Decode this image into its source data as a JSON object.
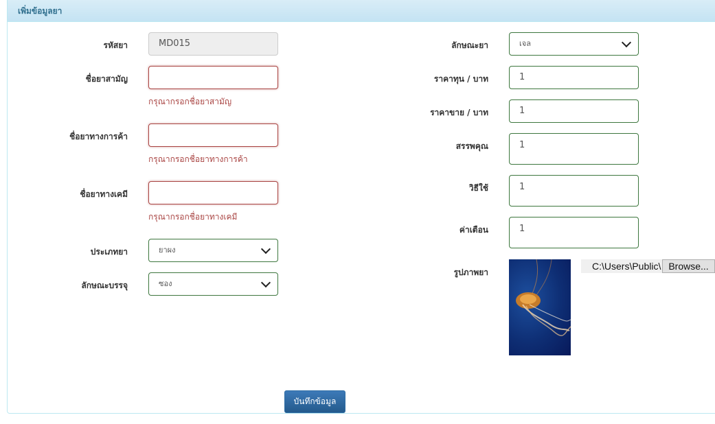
{
  "panel": {
    "title": "เพิ่มข้อมูลยา"
  },
  "left": {
    "code": {
      "label": "รหัสยา",
      "value": "MD015"
    },
    "generic": {
      "label": "ชื่อยาสามัญ",
      "value": "",
      "error": "กรุณากรอกชื่อยาสามัญ"
    },
    "trade": {
      "label": "ชื่อยาทางการค้า",
      "value": "",
      "error": "กรุณากรอกชื่อยาทางการค้า"
    },
    "chemical": {
      "label": "ชื่อยาทางเคมี",
      "value": "",
      "error": "กรุณากรอกชื่อยาทางเคมี"
    },
    "type": {
      "label": "ประเภทยา",
      "value": "ยาผง"
    },
    "package": {
      "label": "ลักษณะบรรจุ",
      "value": "ซอง"
    }
  },
  "right": {
    "form": {
      "label": "ลักษณะยา",
      "value": "เจล"
    },
    "cost": {
      "label": "ราคาทุน / บาท",
      "value": "1"
    },
    "price": {
      "label": "ราคาขาย / บาท",
      "value": "1"
    },
    "properties": {
      "label": "สรรพคุณ",
      "value": "1"
    },
    "usage": {
      "label": "วิธีใช้",
      "value": "1"
    },
    "warning": {
      "label": "ค่าเตือน",
      "value": "1"
    },
    "image": {
      "label": "รูปภาพยา",
      "file_path": "C:\\Users\\Public\\",
      "browse_label": "Browse..."
    }
  },
  "save_label": "บันทึกข้อมูล",
  "colors": {
    "valid": "#3c763d",
    "error": "#a94442",
    "primary": "#337ab7",
    "heading": "#31708f"
  }
}
